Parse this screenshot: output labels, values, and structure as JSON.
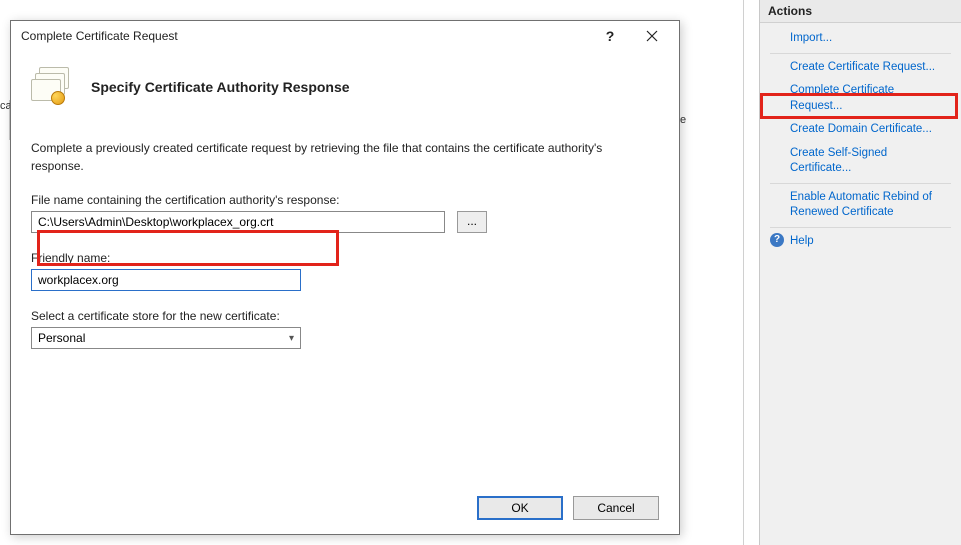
{
  "dialog": {
    "title": "Complete Certificate Request",
    "heading": "Specify Certificate Authority Response",
    "instruction": "Complete a previously created certificate request by retrieving the file that contains the certificate authority's response.",
    "file_label": "File name containing the certification authority's response:",
    "file_value": "C:\\Users\\Admin\\Desktop\\workplacex_org.crt",
    "browse_label": "...",
    "friendly_label": "Friendly name:",
    "friendly_value": "workplacex.org",
    "store_label": "Select a certificate store for the new certificate:",
    "store_value": "Personal",
    "ok_label": "OK",
    "cancel_label": "Cancel",
    "help_glyph": "?",
    "close_glyph": "×"
  },
  "actions": {
    "header": "Actions",
    "items": [
      "Import...",
      "Create Certificate Request...",
      "Complete Certificate Request...",
      "Create Domain Certificate...",
      "Create Self-Signed Certificate...",
      "Enable Automatic Rebind of Renewed Certificate"
    ],
    "help_label": "Help"
  },
  "bg": {
    "left_fragment": "ca",
    "right_fragment": "e"
  }
}
